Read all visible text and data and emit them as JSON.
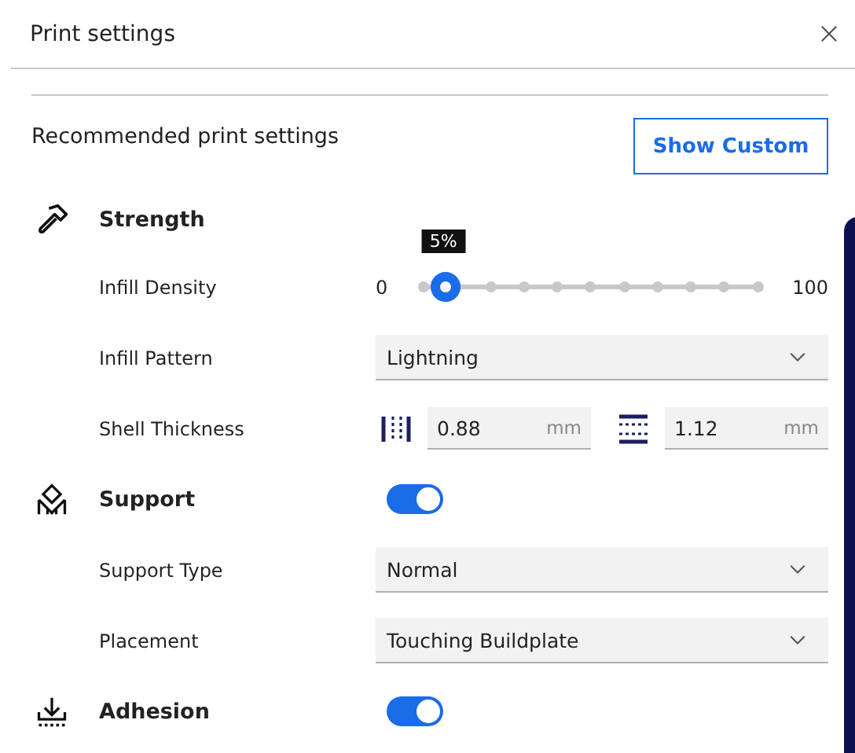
{
  "dialog": {
    "title": "Print settings"
  },
  "header": {
    "title": "Recommended print settings",
    "button": "Show Custom"
  },
  "sections": [
    {
      "kind": "strength",
      "title": "Strength",
      "settings": [
        {
          "kind": "slider",
          "label": "Infill Density",
          "min": "0",
          "max": "100",
          "level": 0.05,
          "tooltip": "5%"
        },
        {
          "kind": "select",
          "label": "Infill Pattern",
          "value": "Lightning"
        },
        {
          "kind": "thickness",
          "label": "Shell Thickness",
          "fields": [
            {
              "kind": "wall",
              "value": "0.88",
              "unit": "mm"
            },
            {
              "kind": "topbottom",
              "value": "1.12",
              "unit": "mm"
            }
          ]
        }
      ]
    },
    {
      "kind": "support",
      "title": "Support",
      "on": true,
      "settings": [
        {
          "kind": "select",
          "label": "Support Type",
          "value": "Normal"
        },
        {
          "kind": "select",
          "label": "Placement",
          "value": "Touching Buildplate"
        }
      ]
    },
    {
      "kind": "adhesion",
      "title": "Adhesion",
      "on": true
    }
  ]
}
